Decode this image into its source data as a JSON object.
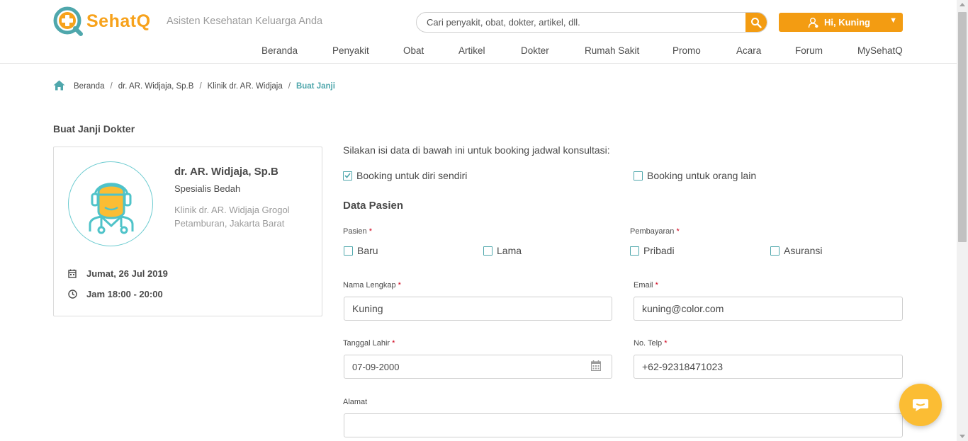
{
  "brand": {
    "name": "SehatQ",
    "tagline": "Asisten Kesehatan Keluarga Anda",
    "accent": "#f39c12",
    "teal": "#4fa7ac"
  },
  "search": {
    "placeholder": "Cari penyakit, obat, dokter, artikel, dll.",
    "icon": "search-icon"
  },
  "user": {
    "greeting": "Hi, Kuning",
    "icon": "user-icon"
  },
  "nav": [
    "Beranda",
    "Penyakit",
    "Obat",
    "Artikel",
    "Dokter",
    "Rumah Sakit",
    "Promo",
    "Acara",
    "Forum",
    "MySehatQ"
  ],
  "breadcrumb": {
    "items": [
      "Beranda",
      "dr. AR. Widjaja, Sp.B",
      "Klinik dr. AR. Widjaja"
    ],
    "current": "Buat Janji"
  },
  "page_title": "Buat Janji Dokter",
  "doctor": {
    "name": "dr. AR. Widjaja, Sp.B",
    "specialty": "Spesialis Bedah",
    "clinic": "Klinik dr. AR. Widjaja Grogol Petamburan, Jakarta Barat",
    "date": "Jumat, 26 Jul 2019",
    "time": "Jam 18:00 - 20:00"
  },
  "form": {
    "intro": "Silakan isi data di bawah ini untuk booking jadwal konsultasi:",
    "booking_self": {
      "label": "Booking untuk diri sendiri",
      "checked": true
    },
    "booking_other": {
      "label": "Booking untuk orang lain",
      "checked": false
    },
    "section_title": "Data Pasien",
    "pasien": {
      "label": "Pasien",
      "required": "*",
      "options": [
        "Baru",
        "Lama"
      ]
    },
    "pembayaran": {
      "label": "Pembayaran",
      "required": "*",
      "options": [
        "Pribadi",
        "Asuransi"
      ]
    },
    "nama": {
      "label": "Nama Lengkap",
      "required": "*",
      "value": "Kuning"
    },
    "email": {
      "label": "Email",
      "required": "*",
      "value": "kuning@color.com"
    },
    "tanggal": {
      "label": "Tanggal Lahir",
      "required": "*",
      "value": "07-09-2000"
    },
    "telp": {
      "label": "No. Telp",
      "required": "*",
      "value": "+62-92318471023"
    },
    "alamat": {
      "label": "Alamat",
      "value": ""
    }
  }
}
